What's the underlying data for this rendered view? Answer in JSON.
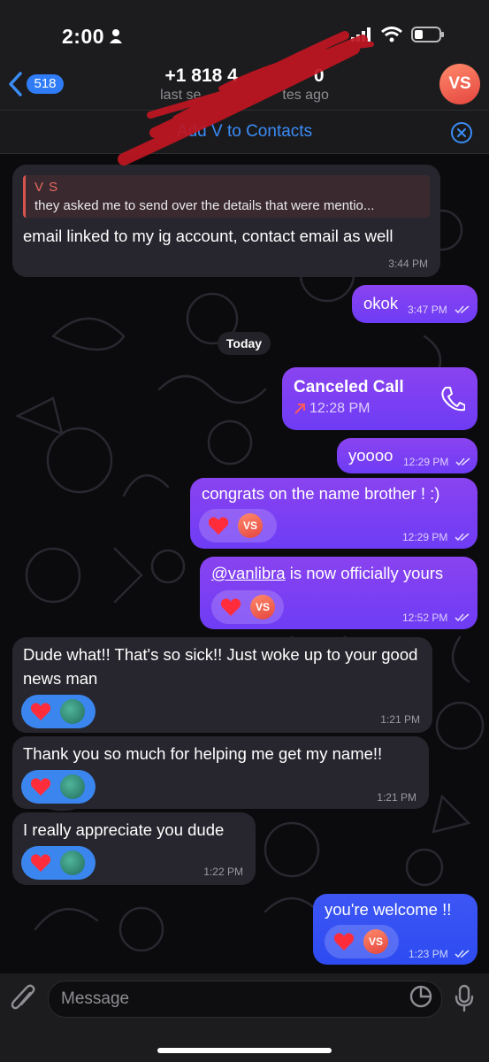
{
  "status_bar": {
    "time": "2:00"
  },
  "header": {
    "back_count": "518",
    "contact_name": "+1 818 4",
    "contact_name_tail": "0",
    "last_seen": "last se",
    "last_seen_tail": "tes ago",
    "avatar_initials": "VS"
  },
  "contacts_bar": {
    "add_label": "Add V to Contacts"
  },
  "messages": [
    {
      "id": "m1",
      "direction": "in",
      "reply_name": "V S",
      "reply_text": "they asked me to send over the details that were mentio...",
      "text": "email linked to my ig account, contact email as well",
      "time": "3:44 PM"
    },
    {
      "id": "m2",
      "direction": "out",
      "text": "okok",
      "time": "3:47 PM"
    },
    {
      "id": "date",
      "date_label": "Today"
    },
    {
      "id": "m3",
      "direction": "out",
      "type": "call",
      "call_title": "Canceled Call",
      "time": "12:28 PM"
    },
    {
      "id": "m4",
      "direction": "out",
      "text": "yoooo",
      "time": "12:29 PM"
    },
    {
      "id": "m5",
      "direction": "out",
      "text": "congrats on the name brother ! :)",
      "time": "12:29 PM",
      "reaction_avatar": "VS"
    },
    {
      "id": "m6",
      "direction": "out",
      "mention": "@vanlibra",
      "text": " is now officially yours",
      "time": "12:52 PM",
      "reaction_avatar": "VS"
    },
    {
      "id": "m7",
      "direction": "in",
      "text": "Dude what!! That's so sick!! Just woke up to your good news man",
      "time": "1:21 PM"
    },
    {
      "id": "m8",
      "direction": "in",
      "text": "Thank you so much for helping me get my name!!",
      "time": "1:21 PM"
    },
    {
      "id": "m9",
      "direction": "in",
      "text": "I really appreciate you dude",
      "time": "1:22 PM"
    },
    {
      "id": "m10",
      "direction": "out",
      "text": "you're welcome !!",
      "time": "1:23 PM",
      "reaction_avatar": "VS"
    }
  ],
  "input": {
    "placeholder": "Message"
  },
  "colors": {
    "outgoing": "#8a43f0",
    "outgoing_last": "#3d56f4",
    "incoming": "#27262e",
    "accent": "#3b8cf7",
    "heart": "#ff2d3b"
  },
  "icons": [
    "back-chevron-icon",
    "person-icon",
    "signal-icon",
    "wifi-icon",
    "battery-icon",
    "close-circle-icon",
    "phone-icon",
    "missed-call-arrow-icon",
    "heart-icon",
    "paperclip-icon",
    "sticker-icon",
    "microphone-icon"
  ]
}
